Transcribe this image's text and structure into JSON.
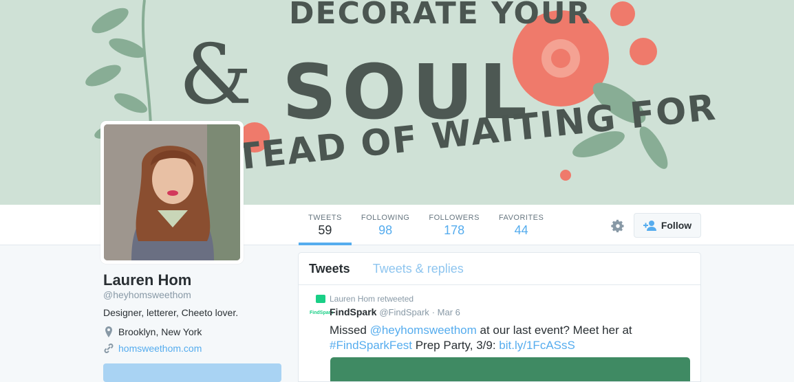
{
  "banner": {
    "line1": "DECORATE YOUR",
    "line2": "SOUL",
    "line3": "TEAD OF WAITING FOR",
    "ampersand": "&"
  },
  "stats": [
    {
      "label": "TWEETS",
      "value": "59"
    },
    {
      "label": "FOLLOWING",
      "value": "98"
    },
    {
      "label": "FOLLOWERS",
      "value": "178"
    },
    {
      "label": "FAVORITES",
      "value": "44"
    }
  ],
  "actions": {
    "gear_icon": "gear-icon",
    "follow_label": "Follow",
    "follow_icon": "add-user-icon"
  },
  "profile": {
    "name": "Lauren Hom",
    "handle": "@heyhomsweethom",
    "bio": "Designer, letterer, Cheeto lover.",
    "location": "Brooklyn, New York",
    "website": "homsweethom.com"
  },
  "timeline": {
    "tabs": [
      "Tweets",
      "Tweets & replies"
    ],
    "tweet": {
      "retweet_note": "Lauren Hom retweeted",
      "logo_text": "FindSpark",
      "author": "FindSpark",
      "handle": "@FindSpark",
      "date": "Mar 6",
      "text_1": "Missed ",
      "mention": "@heyhomsweethom",
      "text_2": " at our last event? Meet her at",
      "hashtag": "#FindSparkFest",
      "text_3": " Prep Party, 3/9: ",
      "link": "bit.ly/1FcASsS"
    }
  },
  "colors": {
    "accent": "#55acee",
    "banner_bg": "#cfe1d6",
    "flower": "#ef7a6b",
    "leaf": "#7fa88d",
    "retweet_green": "#19cf86"
  }
}
